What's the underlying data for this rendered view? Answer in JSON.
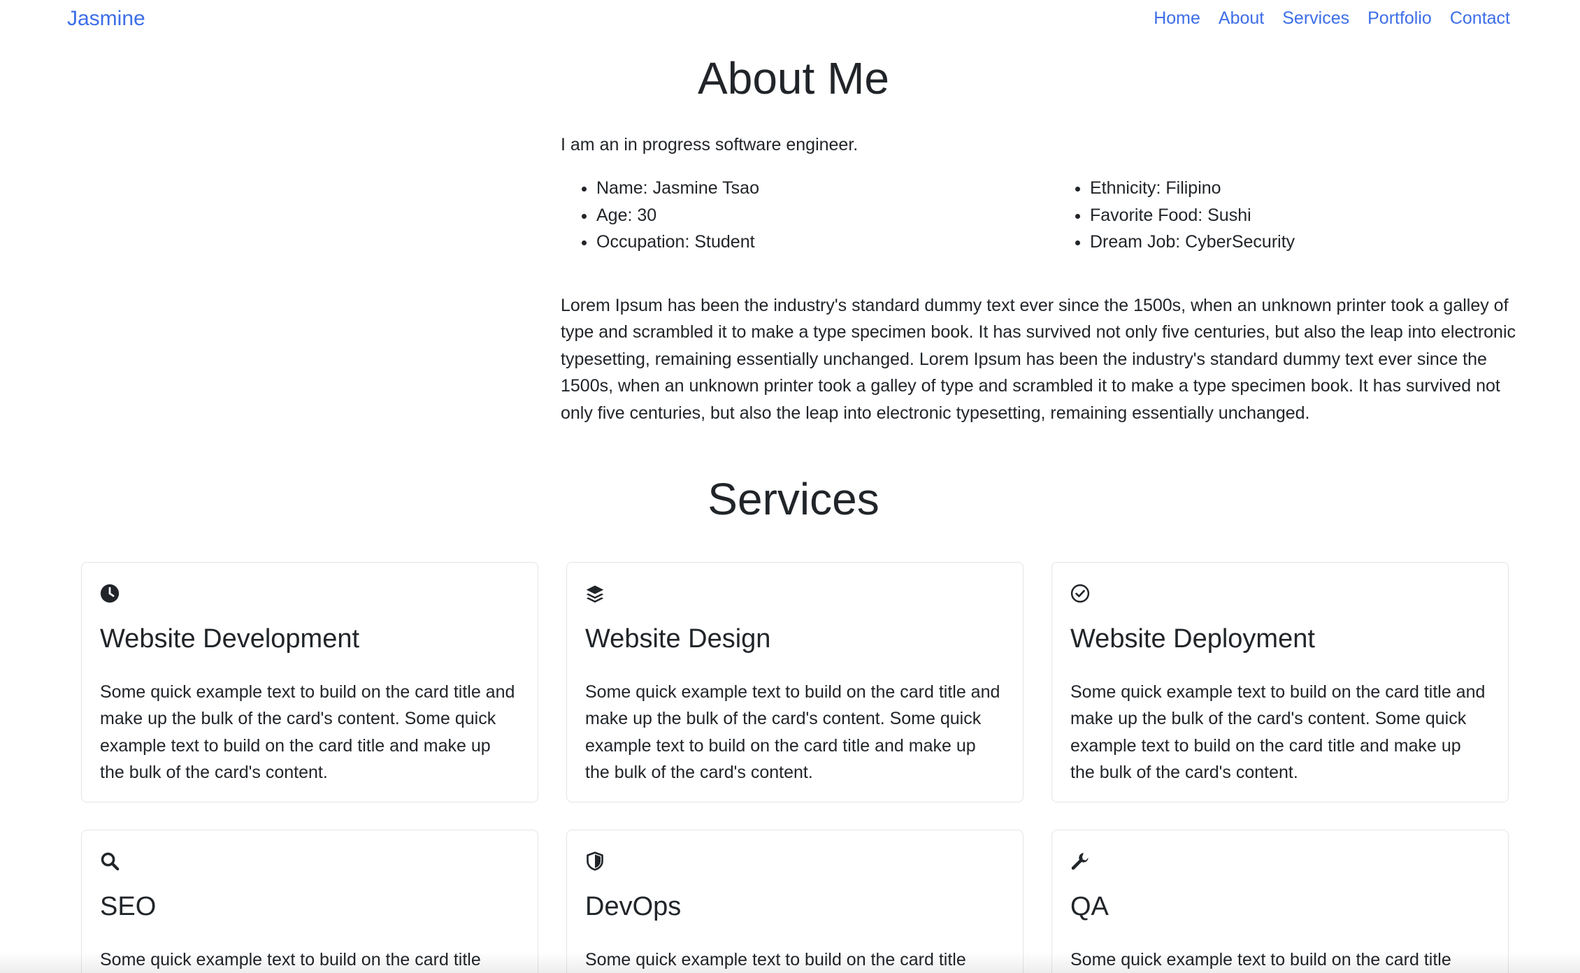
{
  "navbar": {
    "brand": "Jasmine",
    "links": [
      "Home",
      "About",
      "Services",
      "Portfolio",
      "Contact"
    ]
  },
  "about": {
    "title": "About Me",
    "intro": "I am an in progress software engineer.",
    "facts_left": [
      "Name: Jasmine Tsao",
      "Age: 30",
      "Occupation: Student"
    ],
    "facts_right": [
      "Ethnicity: Filipino",
      "Favorite Food: Sushi",
      "Dream Job: CyberSecurity"
    ],
    "bio": "Lorem Ipsum has been the industry's standard dummy text ever since the 1500s, when an unknown printer took a galley of type and scrambled it to make a type specimen book. It has survived not only five centuries, but also the leap into electronic typesetting, remaining essentially unchanged. Lorem Ipsum has been the industry's standard dummy text ever since the 1500s, when an unknown printer took a galley of type and scrambled it to make a type specimen book. It has survived not only five centuries, but also the leap into electronic typesetting, remaining essentially unchanged."
  },
  "services": {
    "title": "Services",
    "cards": [
      {
        "icon": "clock-icon",
        "title": "Website Development",
        "text": "Some quick example text to build on the card title and make up the bulk of the card's content. Some quick example text to build on the card title and make up the bulk of the card's content."
      },
      {
        "icon": "layers-icon",
        "title": "Website Design",
        "text": "Some quick example text to build on the card title and make up the bulk of the card's content. Some quick example text to build on the card title and make up the bulk of the card's content."
      },
      {
        "icon": "check-circle-icon",
        "title": "Website Deployment",
        "text": "Some quick example text to build on the card title and make up the bulk of the card's content. Some quick example text to build on the card title and make up the bulk of the card's content."
      },
      {
        "icon": "search-icon",
        "title": "SEO",
        "text": "Some quick example text to build on the card title"
      },
      {
        "icon": "shield-icon",
        "title": "DevOps",
        "text": "Some quick example text to build on the card title"
      },
      {
        "icon": "wrench-icon",
        "title": "QA",
        "text": "Some quick example text to build on the card title"
      }
    ]
  },
  "colors": {
    "link": "#3d6ee8",
    "text": "#212529",
    "card_border": "#e3e5e8"
  }
}
